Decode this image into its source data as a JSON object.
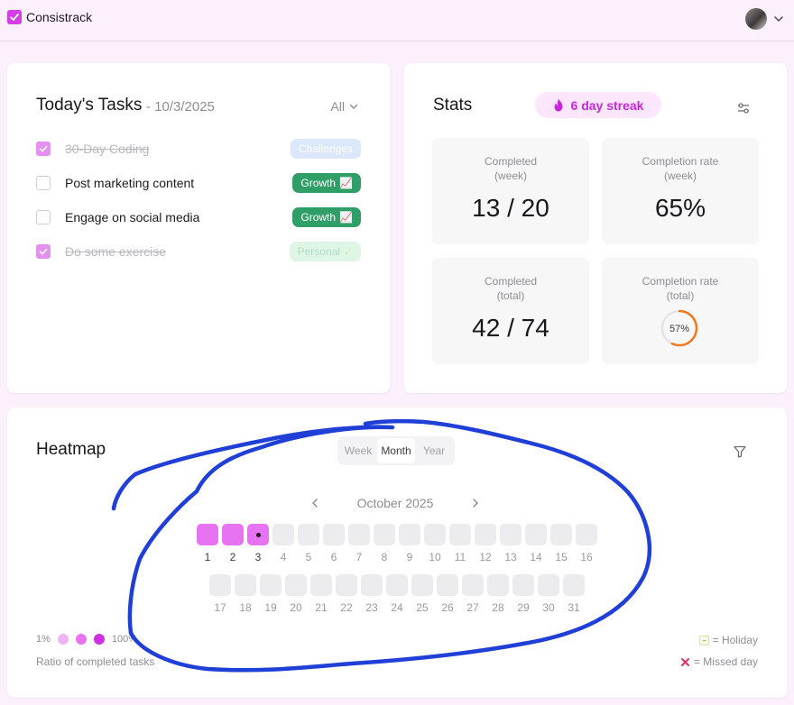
{
  "app": {
    "title": "Consistrack"
  },
  "user": {
    "avatar_icon": "user-avatar",
    "menu_icon": "chevron-down-icon"
  },
  "tasks": {
    "title": "Today's Tasks",
    "date": "- 10/3/2025",
    "filter_label": "All",
    "items": [
      {
        "label": "30-Day Coding",
        "done": true,
        "tag": "Challenges",
        "tag_emoji": ""
      },
      {
        "label": "Post marketing content",
        "done": false,
        "tag": "Growth",
        "tag_emoji": "📈"
      },
      {
        "label": "Engage on social media",
        "done": false,
        "tag": "Growth",
        "tag_emoji": "📈"
      },
      {
        "label": "Do some exercise",
        "done": true,
        "tag": "Personal",
        "tag_emoji": "✓"
      }
    ]
  },
  "stats": {
    "title": "Stats",
    "streak": "6 day streak",
    "boxes": [
      {
        "label1": "Completed",
        "label2": "(week)",
        "value": "13 / 20"
      },
      {
        "label1": "Completion rate",
        "label2": "(week)",
        "value": "65%"
      },
      {
        "label1": "Completed",
        "label2": "(total)",
        "value": "42 / 74"
      },
      {
        "label1": "Completion rate",
        "label2": "(total)",
        "value": "57%",
        "percent": 57
      }
    ]
  },
  "heatmap": {
    "title": "Heatmap",
    "views": [
      "Week",
      "Month",
      "Year"
    ],
    "active_view": "Month",
    "month_label": "October 2025",
    "days": [
      1,
      2,
      3,
      4,
      5,
      6,
      7,
      8,
      9,
      10,
      11,
      12,
      13,
      14,
      15,
      16,
      17,
      18,
      19,
      20,
      21,
      22,
      23,
      24,
      25,
      26,
      27,
      28,
      29,
      30,
      31
    ],
    "completed_days": [
      1,
      2,
      3
    ],
    "today": 3,
    "legend": {
      "min_label": "1%",
      "max_label": "100%",
      "caption": "Ratio of completed tasks",
      "holiday": "= Holiday",
      "missed": "= Missed day"
    }
  },
  "colors": {
    "accent": "#d63de6",
    "heat_low": "#edb3f3",
    "heat_mid": "#e772f2",
    "heat_high": "#cf2ee3",
    "growth": "#2f9e67",
    "annotation": "#1f3fd6"
  }
}
